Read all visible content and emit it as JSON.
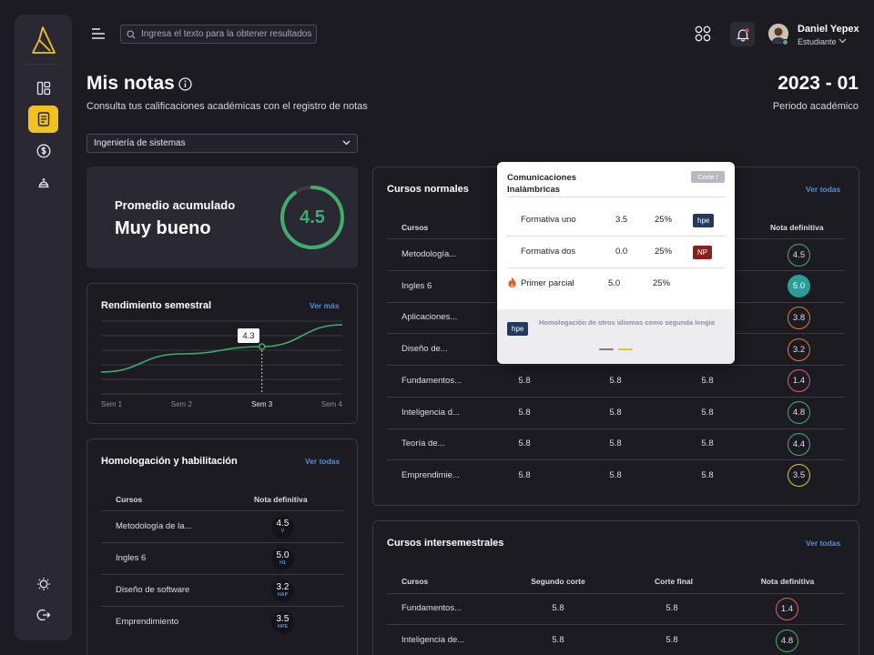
{
  "sidebar": {
    "logo": "app-logo",
    "items": [
      {
        "name": "dashboard",
        "icon": "layout-icon",
        "active": false
      },
      {
        "name": "notas",
        "icon": "document-icon",
        "active": true
      },
      {
        "name": "pagos",
        "icon": "dollar-icon",
        "active": false
      },
      {
        "name": "servicios",
        "icon": "bell-service-icon",
        "active": false
      }
    ],
    "bottom": [
      {
        "name": "theme",
        "icon": "sun-icon"
      },
      {
        "name": "logout",
        "icon": "logout-icon"
      }
    ]
  },
  "topbar": {
    "search_placeholder": "Ingresa el texto para la obtener resultados",
    "user_name": "Daniel Yepex",
    "user_role": "Estudiante"
  },
  "header": {
    "title": "Mis notas",
    "subtitle": "Consulta tus calificaciones académicas con el registro de notas",
    "period_value": "2023 - 01",
    "period_label": "Periodo académico"
  },
  "program_select": {
    "value": "Ingeniería de sistemas"
  },
  "average": {
    "label": "Promedio acumulado",
    "value_text": "Muy bueno",
    "score": "4.5",
    "progress": 0.9,
    "color": "#3fae6a"
  },
  "performance": {
    "title": "Rendimiento semestral",
    "link": "Ver más",
    "highlight_value": "4.3",
    "highlight_index": 2
  },
  "chart_data": {
    "type": "line",
    "categories": [
      "Sem 1",
      "Sem 2",
      "Sem 3",
      "Sem 4"
    ],
    "series": [
      {
        "values": [
          3.6,
          4.1,
          4.3,
          4.9
        ]
      }
    ],
    "ylim": [
      3.0,
      5.0
    ],
    "grid": true
  },
  "homologation": {
    "title": "Homologación y habilitación",
    "link": "Ver todas",
    "headers": [
      "Cursos",
      "Nota definitiva"
    ],
    "rows": [
      {
        "course": "Metodología de la...",
        "grade": "4.5",
        "tag": "V"
      },
      {
        "course": "Ingles 6",
        "grade": "5.0",
        "tag": "H1"
      },
      {
        "course": "Diseño de software",
        "grade": "3.2",
        "tag": "HAP"
      },
      {
        "course": "Emprendimiento",
        "grade": "3.5",
        "tag": "HPE"
      }
    ]
  },
  "normal_courses": {
    "title": "Cursos normales",
    "link": "Ver todas",
    "headers": [
      "Cursos",
      "",
      "",
      "",
      "Nota definitiva"
    ],
    "rows": [
      {
        "course": "Metodología...",
        "c1": "",
        "c2": "",
        "c3": "",
        "grade": "4.5",
        "color": "#3fae6a",
        "filled": false
      },
      {
        "course": "Ingles 6",
        "c1": "",
        "c2": "",
        "c3": "",
        "grade": "5.0",
        "color": "#2a9d98",
        "filled": true
      },
      {
        "course": "Aplicaciones...",
        "c1": "",
        "c2": "",
        "c3": "",
        "grade": "3.8",
        "color": "#e07b39",
        "filled": false
      },
      {
        "course": "Diseño de...",
        "c1": "",
        "c2": "",
        "c3": "",
        "grade": "3.2",
        "color": "#e07b39",
        "filled": false
      },
      {
        "course": "Fundamentos...",
        "c1": "5.8",
        "c2": "5.8",
        "c3": "5.8",
        "grade": "1.4",
        "color": "#e06060",
        "filled": false
      },
      {
        "course": "Inteligencia d...",
        "c1": "5.8",
        "c2": "5.8",
        "c3": "5.8",
        "grade": "4.8",
        "color": "#3fae6a",
        "filled": false
      },
      {
        "course": "Teoría de...",
        "c1": "5.8",
        "c2": "5.8",
        "c3": "5.8",
        "grade": "4.4",
        "color": "#3fae6a",
        "filled": false
      },
      {
        "course": "Emprendimie...",
        "c1": "5.8",
        "c2": "5.8",
        "c3": "5.8",
        "grade": "3.5",
        "color": "#e0c23a",
        "filled": false
      }
    ]
  },
  "intersem_courses": {
    "title": "Cursos intersemestrales",
    "link": "Ver todas",
    "headers": [
      "Cursos",
      "Segundo corte",
      "Corte final",
      "Nota definitiva"
    ],
    "rows": [
      {
        "course": "Fundamentos...",
        "c1": "5.8",
        "c2": "5.8",
        "grade": "1.4",
        "color": "#e06060"
      },
      {
        "course": "Inteligencia de...",
        "c1": "5.8",
        "c2": "5.8",
        "grade": "4.8",
        "color": "#3fae6a"
      }
    ]
  },
  "popup": {
    "title": "Comunicaciones Inalámbricas",
    "badge": "Corte I",
    "rows": [
      {
        "name": "Formativa uno",
        "grade": "3.5",
        "weight": "25%",
        "tag": "hpe",
        "tag_type": "hpe"
      },
      {
        "name": "Formativa dos",
        "grade": "0.0",
        "weight": "25%",
        "tag": "NP",
        "tag_type": "np"
      },
      {
        "name": "Primer parcial",
        "grade": "5.0",
        "weight": "25%",
        "tag": "",
        "tag_type": "",
        "icon": "fire-icon"
      }
    ],
    "footer_tag": "hpe",
    "footer_text": "Homologación de otros idiomas como segunda lengia"
  }
}
